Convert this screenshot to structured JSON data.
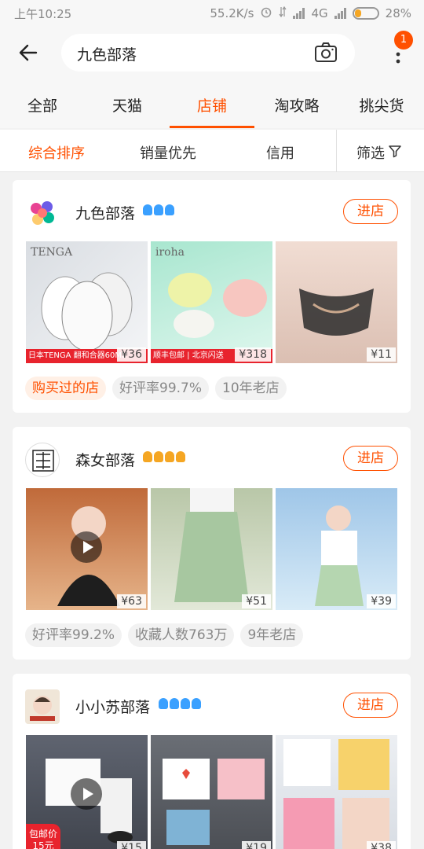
{
  "status_bar": {
    "time": "上午10:25",
    "speed": "55.2K/s",
    "network": "4G",
    "battery": "28%",
    "battery_level": 0.28
  },
  "header": {
    "search_query": "九色部落",
    "notification_count": "1"
  },
  "tabs": [
    {
      "label": "全部",
      "active": false
    },
    {
      "label": "天猫",
      "active": false
    },
    {
      "label": "店铺",
      "active": true
    },
    {
      "label": "淘攻略",
      "active": false
    },
    {
      "label": "挑尖货",
      "active": false
    }
  ],
  "sort": {
    "options": [
      "综合排序",
      "销量优先",
      "信用"
    ],
    "active": "综合排序",
    "filter_label": "筛选"
  },
  "colors": {
    "accent": "#ff5000",
    "diamond": "#3aa0ff",
    "crown": "#f5a623"
  },
  "shops": [
    {
      "name": "九色部落",
      "credit_icon": "diamond-icon",
      "credit_count": 3,
      "enter_label": "进店",
      "products": [
        {
          "price": "¥36",
          "promo": "日本TENGA 翻和合器60ML",
          "brand": "TENGA"
        },
        {
          "price": "¥318",
          "promo": "顺丰包邮 | 北京闪送",
          "brand": "iroha"
        },
        {
          "price": "¥11"
        }
      ],
      "tags": [
        {
          "label": "购买过的店",
          "highlight": true
        },
        {
          "label": "好评率99.7%",
          "highlight": false
        },
        {
          "label": "10年老店",
          "highlight": false
        }
      ]
    },
    {
      "name": "森女部落",
      "credit_icon": "crown-icon",
      "credit_count": 4,
      "enter_label": "进店",
      "products": [
        {
          "price": "¥63",
          "video": true
        },
        {
          "price": "¥51"
        },
        {
          "price": "¥39"
        }
      ],
      "tags": [
        {
          "label": "好评率99.2%",
          "highlight": false
        },
        {
          "label": "收藏人数763万",
          "highlight": false
        },
        {
          "label": "9年老店",
          "highlight": false
        }
      ]
    },
    {
      "name": "小小苏部落",
      "credit_icon": "diamond-icon",
      "credit_count": 4,
      "enter_label": "进店",
      "products": [
        {
          "price": "¥15",
          "video": true,
          "promo": "包邮价 15元"
        },
        {
          "price": "¥19"
        },
        {
          "price": "¥38"
        }
      ],
      "tags": []
    }
  ]
}
